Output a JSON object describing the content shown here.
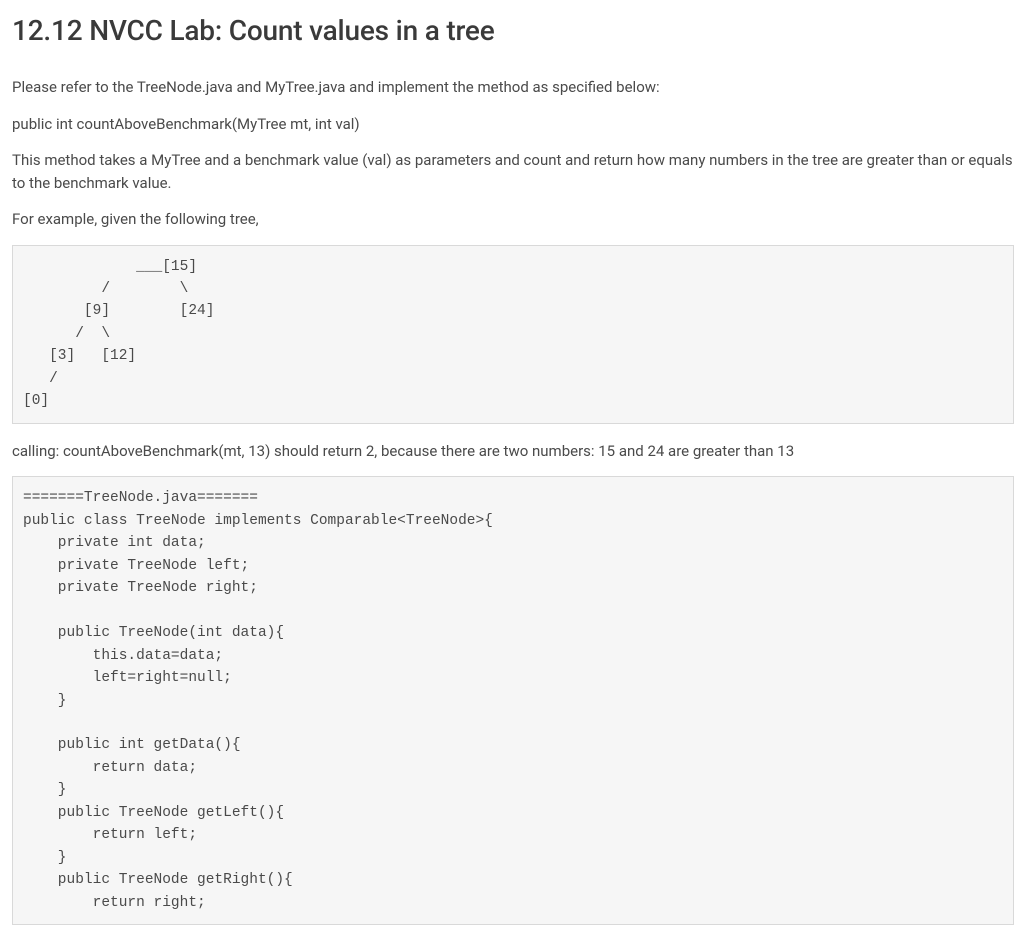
{
  "title": "12.12 NVCC Lab: Count values in a tree",
  "paragraphs": {
    "p1": "Please refer to the TreeNode.java and MyTree.java and implement the method as specified below:",
    "p2": "public int countAboveBenchmark(MyTree mt, int val)",
    "p3": "This method takes a MyTree and a benchmark value (val) as parameters and count and return how many numbers in the tree are greater than or equals to the benchmark value.",
    "p4": "For example, given the following tree,",
    "p5": "calling: countAboveBenchmark(mt, 13) should return 2, because there are two numbers: 15 and 24 are greater than 13"
  },
  "tree_diagram": "             ___[15]\n         /        \\\n       [9]        [24]\n      /  \\\n   [3]   [12]\n   /\n[0]",
  "code_listing": "=======TreeNode.java=======\npublic class TreeNode implements Comparable<TreeNode>{\n    private int data;\n    private TreeNode left;\n    private TreeNode right;\n\n    public TreeNode(int data){\n        this.data=data;\n        left=right=null;\n    }\n\n    public int getData(){\n        return data;\n    }\n    public TreeNode getLeft(){\n        return left;\n    }\n    public TreeNode getRight(){\n        return right;"
}
